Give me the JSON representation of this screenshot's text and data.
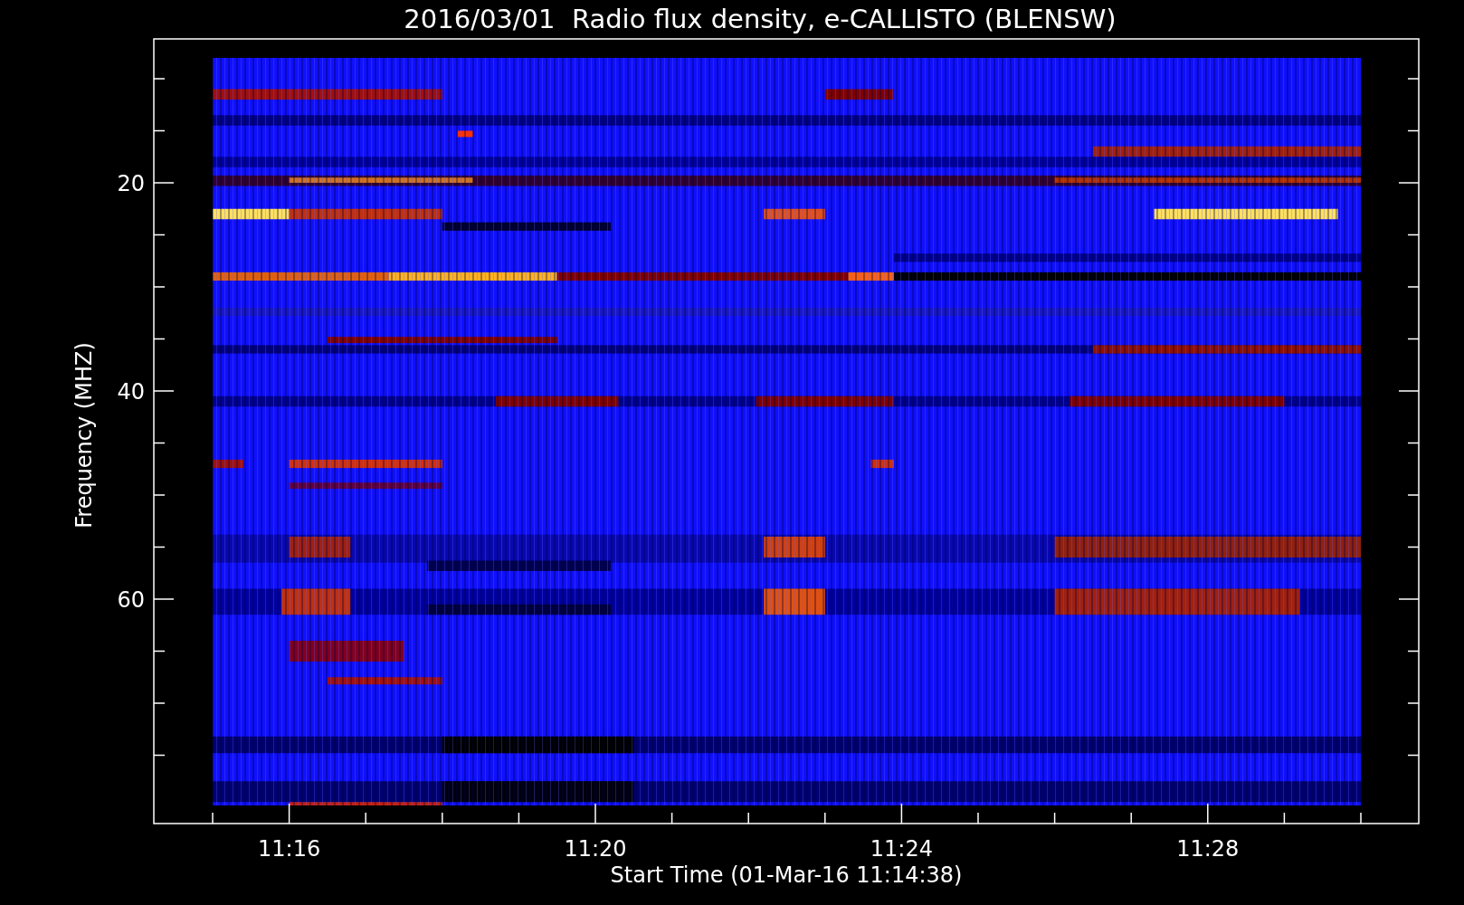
{
  "title": "2016/03/01  Radio flux density, e-CALLISTO (BLENSW)",
  "y_axis": {
    "label": "Frequency (MHZ)",
    "ticks": [
      "20",
      "40",
      "60"
    ]
  },
  "x_axis": {
    "label": "Start Time (01-Mar-16 11:14:38)",
    "ticks": [
      "11:16",
      "11:20",
      "11:24",
      "11:28"
    ]
  }
}
